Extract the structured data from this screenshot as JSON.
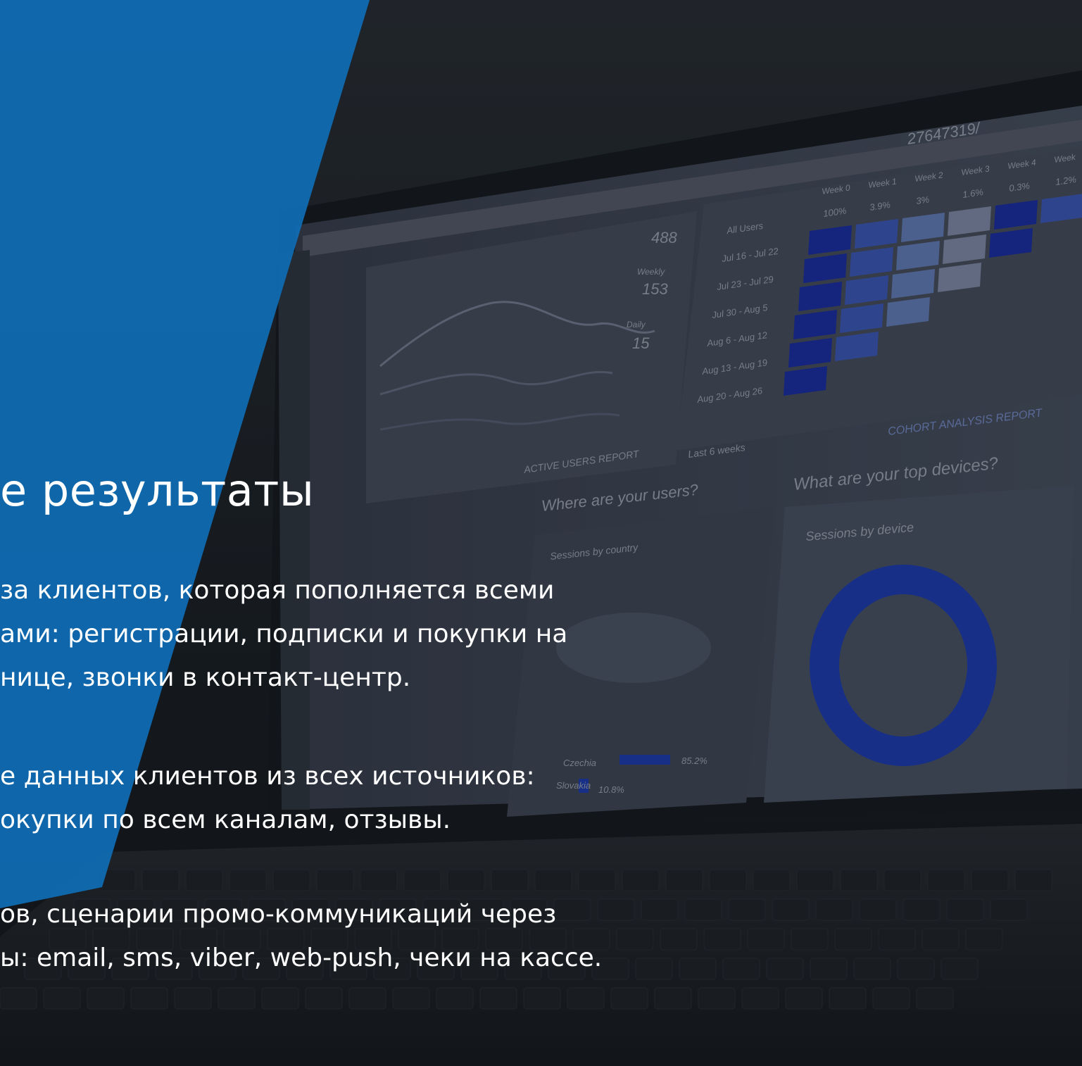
{
  "slide": {
    "title": "е результаты",
    "paragraphs": [
      [
        "за клиентов, которая пополняется всеми",
        "ами: регистрации, подписки и покупки на",
        "нице, звонки в контакт-центр."
      ],
      [
        "е данных клиентов из всех источников:",
        "окупки по всем каналам, отзывы."
      ],
      [
        "ов, сценарии промо-коммуникаций через",
        "ы: email, sms, viber, web-push, чеки на кассе."
      ]
    ]
  },
  "background": {
    "url_text": "27647319/",
    "cohort": {
      "weeks": [
        "Week 0",
        "Week 1",
        "Week 2",
        "Week 3",
        "Week 4",
        "Week"
      ],
      "percents": [
        "100%",
        "3.9%",
        "3%",
        "1.6%",
        "0.3%",
        "1.2%"
      ],
      "rows": [
        "All Users",
        "Jul 16 - Jul 22",
        "Jul 23 - Jul 29",
        "Jul 30 - Aug 5",
        "Aug 6 - Aug 12",
        "Aug 13 - Aug 19",
        "Aug 20 - Aug 26"
      ],
      "link": "COHORT ANALYSIS REPORT",
      "range": "Last 6 weeks"
    },
    "active_users": {
      "values": [
        "488",
        "153",
        "15"
      ],
      "legend": [
        "Weekly",
        "Daily"
      ],
      "link": "ACTIVE USERS REPORT"
    },
    "users_map": {
      "question": "Where are your users?",
      "subtitle": "Sessions by country",
      "countries": [
        "Czechia",
        "Slovakia"
      ],
      "values": [
        "85.2%",
        "10.8%"
      ]
    },
    "devices": {
      "question": "What are your top devices?",
      "subtitle": "Sessions by device"
    },
    "colors": {
      "banner": "#0f6db5",
      "cell_dark": "#1a2fb0",
      "cell_mid": "#3f5fc8",
      "cell_light": "#6b86c9",
      "donut": "#1d3fbf"
    }
  }
}
